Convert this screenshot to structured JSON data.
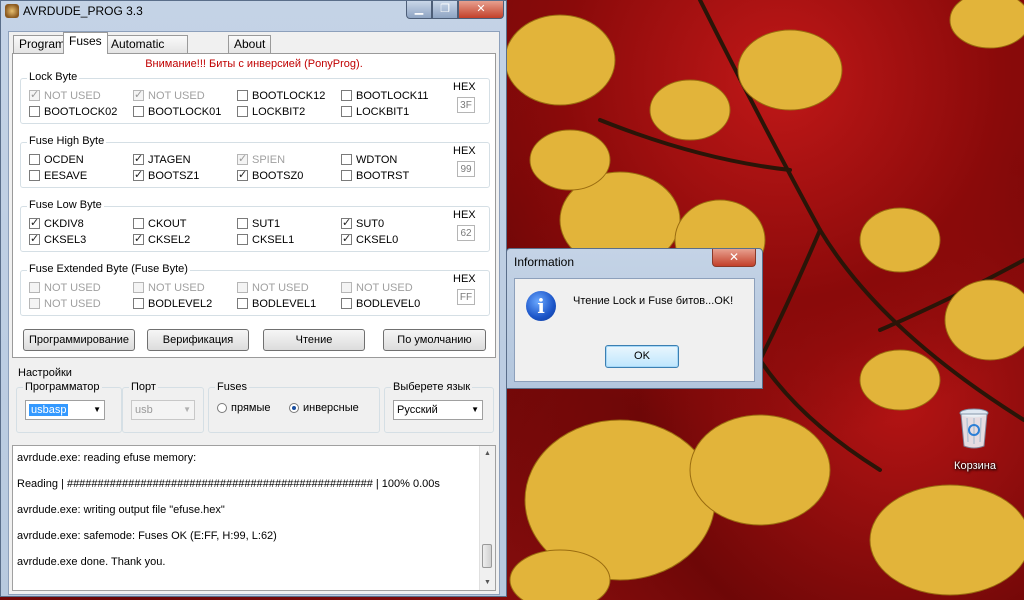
{
  "window": {
    "title": "AVRDUDE_PROG 3.3",
    "min": "▁",
    "max": "❐",
    "close": "✕"
  },
  "tabs": [
    {
      "label": "Program"
    },
    {
      "label": "Fuses"
    },
    {
      "label": "Automatic programming"
    },
    {
      "label": "About"
    }
  ],
  "warning": "Внимание!!! Биты с инверсией (PonyProg).",
  "groups": [
    {
      "label": "Lock Byte",
      "hex_label": "HEX",
      "hex": "3F",
      "bits": [
        {
          "label": "NOT USED",
          "checked": true,
          "disabled": true
        },
        {
          "label": "NOT USED",
          "checked": true,
          "disabled": true
        },
        {
          "label": "BOOTLOCK12",
          "checked": false,
          "disabled": false
        },
        {
          "label": "BOOTLOCK11",
          "checked": false,
          "disabled": false
        },
        {
          "label": "BOOTLOCK02",
          "checked": false,
          "disabled": false
        },
        {
          "label": "BOOTLOCK01",
          "checked": false,
          "disabled": false
        },
        {
          "label": "LOCKBIT2",
          "checked": false,
          "disabled": false
        },
        {
          "label": "LOCKBIT1",
          "checked": false,
          "disabled": false
        }
      ]
    },
    {
      "label": "Fuse High Byte",
      "hex_label": "HEX",
      "hex": "99",
      "bits": [
        {
          "label": "OCDEN",
          "checked": false,
          "disabled": false
        },
        {
          "label": "JTAGEN",
          "checked": true,
          "disabled": false
        },
        {
          "label": "SPIEN",
          "checked": true,
          "disabled": true
        },
        {
          "label": "WDTON",
          "checked": false,
          "disabled": false
        },
        {
          "label": "EESAVE",
          "checked": false,
          "disabled": false
        },
        {
          "label": "BOOTSZ1",
          "checked": true,
          "disabled": false
        },
        {
          "label": "BOOTSZ0",
          "checked": true,
          "disabled": false
        },
        {
          "label": "BOOTRST",
          "checked": false,
          "disabled": false
        }
      ]
    },
    {
      "label": "Fuse Low Byte",
      "hex_label": "HEX",
      "hex": "62",
      "bits": [
        {
          "label": "CKDIV8",
          "checked": true,
          "disabled": false
        },
        {
          "label": "CKOUT",
          "checked": false,
          "disabled": false
        },
        {
          "label": "SUT1",
          "checked": false,
          "disabled": false
        },
        {
          "label": "SUT0",
          "checked": true,
          "disabled": false
        },
        {
          "label": "CKSEL3",
          "checked": true,
          "disabled": false
        },
        {
          "label": "CKSEL2",
          "checked": true,
          "disabled": false
        },
        {
          "label": "CKSEL1",
          "checked": false,
          "disabled": false
        },
        {
          "label": "CKSEL0",
          "checked": true,
          "disabled": false
        }
      ]
    },
    {
      "label": "Fuse Extended Byte (Fuse Byte)",
      "hex_label": "HEX",
      "hex": "FF",
      "bits": [
        {
          "label": "NOT USED",
          "checked": false,
          "disabled": true
        },
        {
          "label": "NOT USED",
          "checked": false,
          "disabled": true
        },
        {
          "label": "NOT USED",
          "checked": false,
          "disabled": true
        },
        {
          "label": "NOT USED",
          "checked": false,
          "disabled": true
        },
        {
          "label": "NOT USED",
          "checked": false,
          "disabled": true
        },
        {
          "label": "BODLEVEL2",
          "checked": false,
          "disabled": false
        },
        {
          "label": "BODLEVEL1",
          "checked": false,
          "disabled": false
        },
        {
          "label": "BODLEVEL0",
          "checked": false,
          "disabled": false
        }
      ]
    }
  ],
  "actions": {
    "program": "Программирование",
    "verify": "Верификация",
    "read": "Чтение",
    "default": "По умолчанию"
  },
  "settings": {
    "title": "Настройки",
    "programmer_label": "Программатор",
    "programmer_value": "usbasp",
    "port_label": "Порт",
    "port_value": "usb",
    "fuses_label": "Fuses",
    "radio_direct": "прямые",
    "radio_inverse": "инверсные",
    "radio_selected": "inverse",
    "language_label": "Выберете язык",
    "language_value": "Русский"
  },
  "log": [
    "avrdude.exe: reading efuse memory:",
    "Reading | ################################################## | 100% 0.00s",
    "avrdude.exe: writing output file \"efuse.hex\"",
    "avrdude.exe: safemode: Fuses OK (E:FF, H:99, L:62)",
    "avrdude.exe done.  Thank you."
  ],
  "dialog": {
    "title": "Information",
    "close": "✕",
    "icon_text": "i",
    "message": "Чтение Lock и Fuse битов...OK!",
    "ok": "OK"
  },
  "desktop": {
    "recycle_bin_label": "Корзина"
  }
}
